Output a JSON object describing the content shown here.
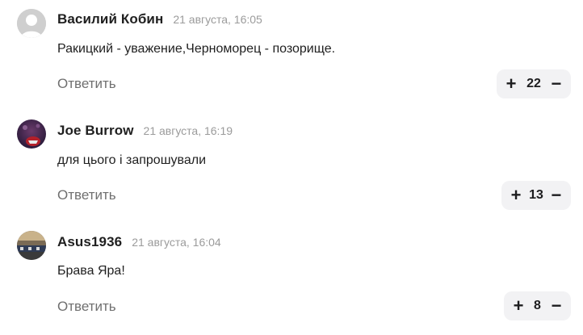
{
  "comments": [
    {
      "author": "Василий Кобин",
      "date": "21 августа, 16:05",
      "text": "Ракицкий - уважение,Черноморец - позорище.",
      "reply_label": "Ответить",
      "votes": {
        "plus": "+",
        "count": "22",
        "minus": "−"
      },
      "avatar": "default-user-icon"
    },
    {
      "author": "Joe Burrow",
      "date": "21 августа, 16:19",
      "text": "для цього і запрошували",
      "reply_label": "Ответить",
      "votes": {
        "plus": "+",
        "count": "13",
        "minus": "−"
      },
      "avatar": "photo"
    },
    {
      "author": "Asus1936",
      "date": "21 августа, 16:04",
      "text": "Брава Яра!",
      "reply_label": "Ответить",
      "votes": {
        "plus": "+",
        "count": "8",
        "minus": "−"
      },
      "avatar": "photo"
    }
  ]
}
